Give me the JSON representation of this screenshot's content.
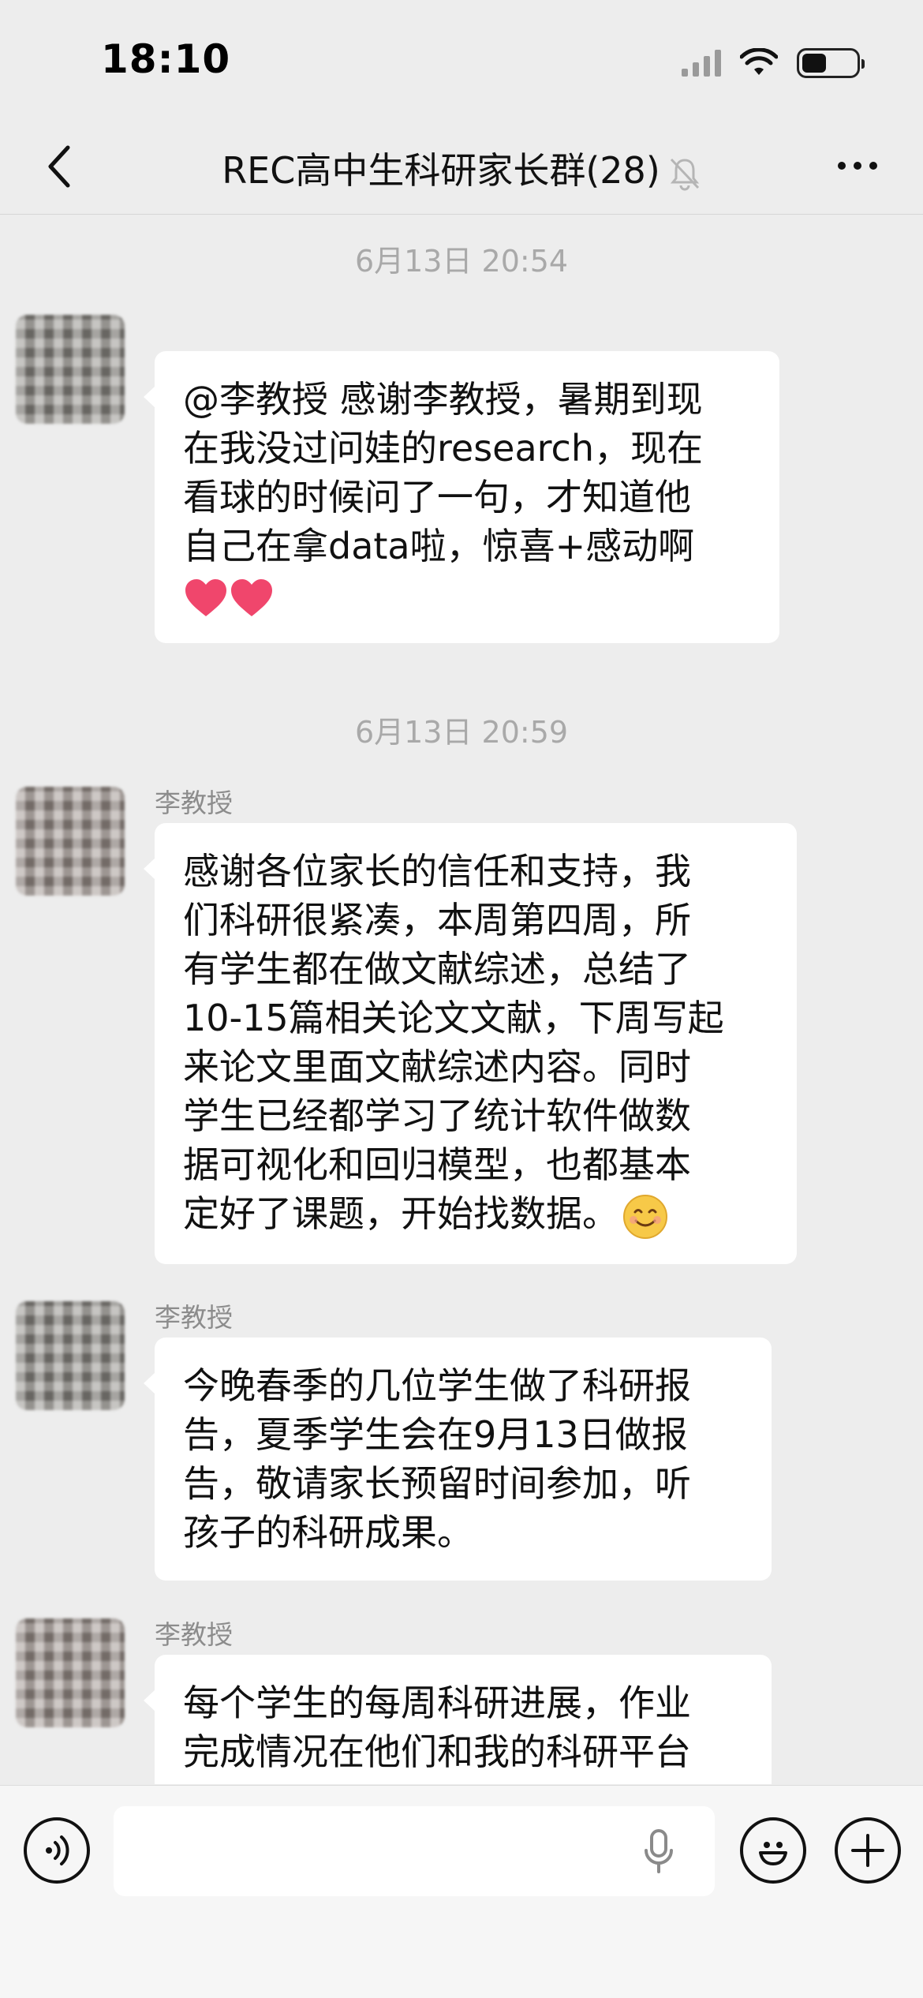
{
  "status_bar": {
    "time": "18:10",
    "signal_icon": "cellular-signal-icon",
    "wifi_icon": "wifi-icon",
    "battery_icon": "battery-icon",
    "battery_level": 0.45
  },
  "header": {
    "title": "REC高中生科研家长群(28)",
    "back_icon": "chevron-left-icon",
    "mute_icon": "bell-muted-icon",
    "more_icon": "more-dots-icon"
  },
  "messages": [
    {
      "type": "timestamp",
      "text": "6月13日 20:54"
    },
    {
      "type": "message",
      "sender": "",
      "lines": [
        "@李教授 感谢李教授，暑期到现",
        "在我没过问娃的research，现在",
        "看球的时候问了一句，才知道他",
        "自己在拿data啦，惊喜+感动啊"
      ],
      "emoji": "❤️❤️"
    },
    {
      "type": "timestamp",
      "text": "6月13日 20:59"
    },
    {
      "type": "message",
      "sender": "李教授",
      "lines": [
        "感谢各位家长的信任和支持，我",
        "们科研很紧凑，本周第四周，所",
        "有学生都在做文献综述，总结了",
        "10-15篇相关论文文献，下周写起",
        "来论文里面文献综述内容。同时",
        "学生已经都学习了统计软件做数",
        "据可视化和回归模型，也都基本",
        "定好了课题，开始找数据。"
      ],
      "emoji": "😊"
    },
    {
      "type": "message",
      "sender": "李教授",
      "lines": [
        "今晚春季的几位学生做了科研报",
        "告，夏季学生会在9月13日做报",
        "告，敬请家长预留时间参加，听",
        "孩子的科研成果。"
      ]
    },
    {
      "type": "message",
      "sender": "李教授",
      "lines": [
        "每个学生的每周科研进展，作业",
        "完成情况在他们和我的科研平台"
      ]
    }
  ],
  "input_bar": {
    "voice_icon": "voice-input-icon",
    "mic_icon": "microphone-icon",
    "emoji_icon": "emoji-icon",
    "plus_icon": "plus-icon",
    "input_value": ""
  },
  "colors": {
    "background": "#ededed",
    "bubble": "#ffffff",
    "timestamp_text": "#a9a9a9",
    "sender_text": "#8c8c8c",
    "heart": "#f0466c"
  }
}
